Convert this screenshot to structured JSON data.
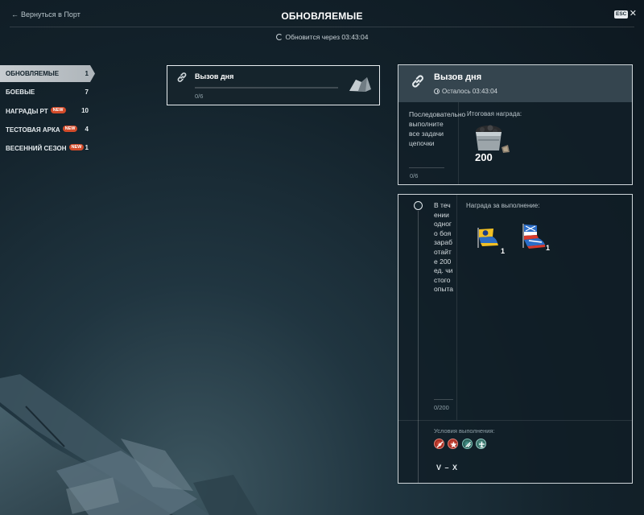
{
  "header": {
    "back_label": "Вернуться в Порт",
    "title": "ОБНОВЛЯЕМЫЕ",
    "esc_label": "ESC",
    "refresh_text": "Обновится через 03:43:04"
  },
  "sidebar": {
    "items": [
      {
        "label": "ОБНОВЛЯЕМЫЕ",
        "count": "1",
        "new": false,
        "active": true
      },
      {
        "label": "БОЕВЫЕ",
        "count": "7",
        "new": false,
        "active": false
      },
      {
        "label": "НАГРАДЫ РТ",
        "count": "10",
        "new": true,
        "active": false
      },
      {
        "label": "ТЕСТОВАЯ АРКА",
        "count": "4",
        "new": true,
        "active": false
      },
      {
        "label": "ВЕСЕННИЙ СЕЗОН",
        "count": "1",
        "new": true,
        "active": false
      }
    ],
    "new_badge": "NEW"
  },
  "chain_card": {
    "name": "Вызов дня",
    "progress_text": "0/6",
    "progress_fraction": 0,
    "icon": "link-icon",
    "reward_icon": "ore-icon"
  },
  "detail": {
    "title": "Вызов дня",
    "timer": "Осталось 03:43:04",
    "description": "Последовательно выполните все задачи цепочки",
    "progress": "0/6",
    "final_reward_label": "Итоговая награда:",
    "final_reward_amount": "200",
    "final_reward_icon": "coal-cart-icon"
  },
  "task": {
    "description": "В течении одного боя заработайте 200 ед. чистого опыта",
    "progress": "0/200",
    "reward_label": "Награда за выполнение:",
    "rewards": [
      {
        "icon": "signal-flag-yellow-icon",
        "qty": "1"
      },
      {
        "icon": "signal-flag-blue-red-icon",
        "qty": "1"
      }
    ],
    "conditions_label": "Условия выполнения:",
    "conditions_icons": [
      "battleship-icon",
      "cruiser-icon",
      "destroyer-icon",
      "aircraft-carrier-icon"
    ],
    "tier_range": "V – X"
  },
  "colors": {
    "accent_new": "#d24b2a",
    "panel_border": "#cfd6da",
    "active_tab": "#c7ccd0"
  }
}
